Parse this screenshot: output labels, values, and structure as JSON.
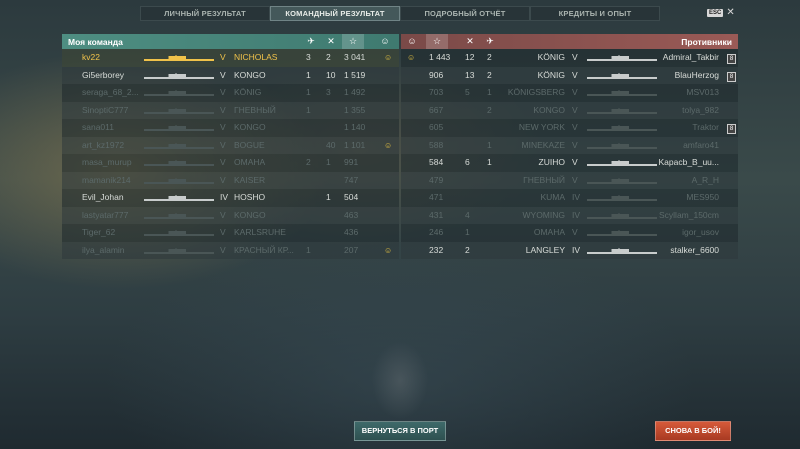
{
  "tabs": [
    "ЛИЧНЫЙ РЕЗУЛЬТАТ",
    "КОМАНДНЫЙ РЕЗУЛЬТАТ",
    "ПОДРОБНЫЙ ОТЧЁТ",
    "КРЕДИТЫ И ОПЫТ"
  ],
  "active_tab": 1,
  "esc_label": "ESC",
  "close_glyph": "✕",
  "my_team": {
    "title": "Моя команда",
    "players": [
      {
        "name": "kv22",
        "tier": "V",
        "ship": "NICHOLAS",
        "kills": "3",
        "planes": "2",
        "score": "3 041",
        "smile": true,
        "me": true,
        "dead": false
      },
      {
        "name": "Gi5erborey",
        "tier": "V",
        "ship": "KONGO",
        "kills": "1",
        "planes": "10",
        "score": "1 519",
        "smile": false,
        "me": false,
        "dead": false
      },
      {
        "name": "seraga_68_2...",
        "tier": "V",
        "ship": "KÖNIG",
        "kills": "1",
        "planes": "3",
        "score": "1 492",
        "smile": false,
        "me": false,
        "dead": true
      },
      {
        "name": "SinoptiC777",
        "tier": "V",
        "ship": "ГНЕВНЫЙ",
        "kills": "1",
        "planes": "",
        "score": "1 355",
        "smile": false,
        "me": false,
        "dead": true
      },
      {
        "name": "sana011",
        "tier": "V",
        "ship": "KONGO",
        "kills": "",
        "planes": "",
        "score": "1 140",
        "smile": false,
        "me": false,
        "dead": true
      },
      {
        "name": "art_kz1972",
        "tier": "V",
        "ship": "BOGUE",
        "kills": "",
        "planes": "40",
        "score": "1 101",
        "smile": true,
        "me": false,
        "dead": true
      },
      {
        "name": "masa_murup",
        "tier": "V",
        "ship": "OMAHA",
        "kills": "2",
        "planes": "1",
        "score": "991",
        "smile": false,
        "me": false,
        "dead": true
      },
      {
        "name": "mamanik214",
        "tier": "V",
        "ship": "KAISER",
        "kills": "",
        "planes": "",
        "score": "747",
        "smile": false,
        "me": false,
        "dead": true
      },
      {
        "name": "Evil_Johan",
        "tier": "IV",
        "ship": "HOSHO",
        "kills": "",
        "planes": "1",
        "score": "504",
        "smile": false,
        "me": false,
        "dead": false
      },
      {
        "name": "lastyatar777",
        "tier": "V",
        "ship": "KONGO",
        "kills": "",
        "planes": "",
        "score": "463",
        "smile": false,
        "me": false,
        "dead": true
      },
      {
        "name": "Tiger_62",
        "tier": "V",
        "ship": "KARLSRUHE",
        "kills": "",
        "planes": "",
        "score": "436",
        "smile": false,
        "me": false,
        "dead": true
      },
      {
        "name": "ilya_alamin",
        "tier": "V",
        "ship": "КРАСНЫЙ КР...",
        "kills": "1",
        "planes": "",
        "score": "207",
        "smile": true,
        "me": false,
        "dead": true
      }
    ]
  },
  "enemy_team": {
    "title": "Противники",
    "players": [
      {
        "score": "1 443",
        "planes": "12",
        "kills": "2",
        "ship": "KÖNIG",
        "tier": "V",
        "name": "Admiral_Takbir",
        "smile": true,
        "lock": true,
        "dead": false
      },
      {
        "score": "906",
        "planes": "13",
        "kills": "2",
        "ship": "KÖNIG",
        "tier": "V",
        "name": "BlauHerzog",
        "smile": false,
        "lock": true,
        "dead": false
      },
      {
        "score": "703",
        "planes": "5",
        "kills": "1",
        "ship": "KÖNIGSBERG",
        "tier": "V",
        "name": "MSV013",
        "smile": false,
        "lock": false,
        "dead": true
      },
      {
        "score": "667",
        "planes": "",
        "kills": "2",
        "ship": "KONGO",
        "tier": "V",
        "name": "tolya_982",
        "smile": false,
        "lock": false,
        "dead": true
      },
      {
        "score": "605",
        "planes": "",
        "kills": "",
        "ship": "NEW YORK",
        "tier": "V",
        "name": "Traktor",
        "smile": false,
        "lock": true,
        "dead": true
      },
      {
        "score": "588",
        "planes": "",
        "kills": "1",
        "ship": "MINEKAZE",
        "tier": "V",
        "name": "amfaro41",
        "smile": false,
        "lock": false,
        "dead": true
      },
      {
        "score": "584",
        "planes": "6",
        "kills": "1",
        "ship": "ZUIHO",
        "tier": "V",
        "name": "Kapacb_B_uu...",
        "smile": false,
        "lock": false,
        "dead": false
      },
      {
        "score": "479",
        "planes": "",
        "kills": "",
        "ship": "ГНЕВНЫЙ",
        "tier": "V",
        "name": "A_R_H",
        "smile": false,
        "lock": false,
        "dead": true
      },
      {
        "score": "471",
        "planes": "",
        "kills": "",
        "ship": "KUMA",
        "tier": "IV",
        "name": "MES950",
        "smile": false,
        "lock": false,
        "dead": true
      },
      {
        "score": "431",
        "planes": "4",
        "kills": "",
        "ship": "WYOMING",
        "tier": "IV",
        "name": "Scyllam_150cm",
        "smile": false,
        "lock": false,
        "dead": true
      },
      {
        "score": "246",
        "planes": "1",
        "kills": "",
        "ship": "OMAHA",
        "tier": "V",
        "name": "igor_usov",
        "smile": false,
        "lock": false,
        "dead": true
      },
      {
        "score": "232",
        "planes": "2",
        "kills": "",
        "ship": "LANGLEY",
        "tier": "IV",
        "name": "stalker_6600",
        "smile": false,
        "lock": false,
        "dead": false
      }
    ]
  },
  "buttons": {
    "port": "ВЕРНУТЬСЯ В ПОРТ",
    "battle": "СНОВА В БОЙ!"
  },
  "icons": {
    "plane": "✈",
    "kill": "✕",
    "star": "☆",
    "smile": "☺"
  },
  "colors": {
    "my_team_header": "#4e8e82",
    "enemy_header": "#9a5a56",
    "gold": "#f0c24a",
    "battle_button": "#d65a3a"
  }
}
